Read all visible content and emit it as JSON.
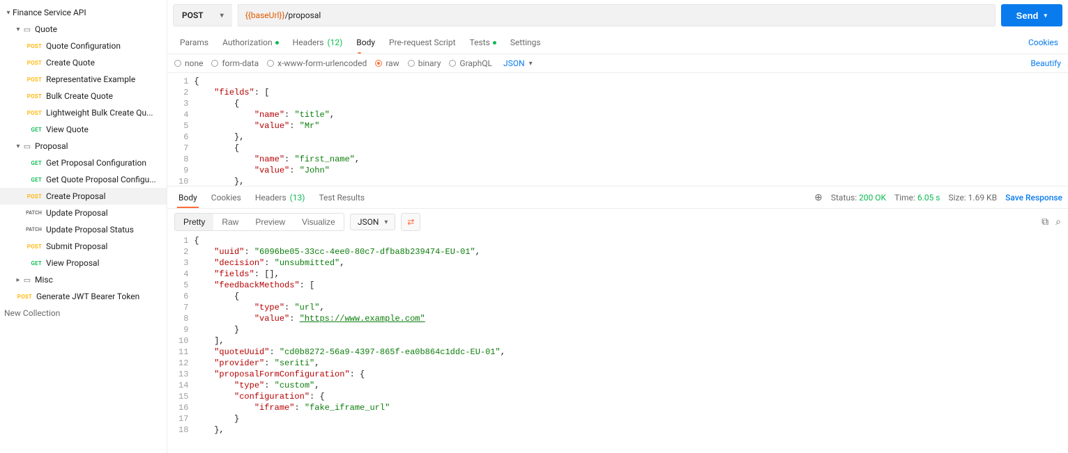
{
  "sidebar": {
    "root": "Finance Service API",
    "folders": [
      {
        "name": "Quote",
        "items": [
          {
            "method": "POST",
            "label": "Quote Configuration"
          },
          {
            "method": "POST",
            "label": "Create Quote"
          },
          {
            "method": "POST",
            "label": "Representative Example"
          },
          {
            "method": "POST",
            "label": "Bulk Create Quote"
          },
          {
            "method": "POST",
            "label": "Lightweight Bulk Create Qu..."
          },
          {
            "method": "GET",
            "label": "View Quote"
          }
        ]
      },
      {
        "name": "Proposal",
        "items": [
          {
            "method": "GET",
            "label": "Get Proposal Configuration"
          },
          {
            "method": "GET",
            "label": "Get Quote Proposal Configu..."
          },
          {
            "method": "POST",
            "label": "Create Proposal",
            "selected": true
          },
          {
            "method": "PATCH",
            "label": "Update Proposal"
          },
          {
            "method": "PATCH",
            "label": "Update Proposal Status"
          },
          {
            "method": "POST",
            "label": "Submit Proposal"
          },
          {
            "method": "GET",
            "label": "View Proposal"
          }
        ]
      },
      {
        "name": "Misc",
        "collapsed": true,
        "items": []
      }
    ],
    "loose": [
      {
        "method": "POST",
        "label": "Generate JWT Bearer Token"
      }
    ],
    "new_collection": "New Collection"
  },
  "request": {
    "method": "POST",
    "url_var": "{{baseUrl}}",
    "url_path": "/proposal",
    "send": "Send",
    "tabs": {
      "params": "Params",
      "auth": "Authorization",
      "headers": "Headers",
      "headers_count": "(12)",
      "body": "Body",
      "prereq": "Pre-request Script",
      "tests": "Tests",
      "settings": "Settings"
    },
    "cookies_link": "Cookies",
    "body_types": {
      "none": "none",
      "form_data": "form-data",
      "urlencoded": "x-www-form-urlencoded",
      "raw": "raw",
      "binary": "binary",
      "graphql": "GraphQL",
      "raw_lang": "JSON"
    },
    "beautify": "Beautify",
    "body_lines": [
      [
        [
          "p",
          "{"
        ]
      ],
      [
        [
          "p",
          "    "
        ],
        [
          "k",
          "\"fields\""
        ],
        [
          "p",
          ": ["
        ]
      ],
      [
        [
          "p",
          "        {"
        ]
      ],
      [
        [
          "p",
          "            "
        ],
        [
          "k",
          "\"name\""
        ],
        [
          "p",
          ": "
        ],
        [
          "s",
          "\"title\""
        ],
        [
          "p",
          ","
        ]
      ],
      [
        [
          "p",
          "            "
        ],
        [
          "k",
          "\"value\""
        ],
        [
          "p",
          ": "
        ],
        [
          "s",
          "\"Mr\""
        ]
      ],
      [
        [
          "p",
          "        },"
        ]
      ],
      [
        [
          "p",
          "        {"
        ]
      ],
      [
        [
          "p",
          "            "
        ],
        [
          "k",
          "\"name\""
        ],
        [
          "p",
          ": "
        ],
        [
          "s",
          "\"first_name\""
        ],
        [
          "p",
          ","
        ]
      ],
      [
        [
          "p",
          "            "
        ],
        [
          "k",
          "\"value\""
        ],
        [
          "p",
          ": "
        ],
        [
          "s",
          "\"John\""
        ]
      ],
      [
        [
          "p",
          "        },"
        ]
      ]
    ]
  },
  "response": {
    "tabs": {
      "body": "Body",
      "cookies": "Cookies",
      "headers": "Headers",
      "headers_count": "(13)",
      "test_results": "Test Results"
    },
    "status_label": "Status:",
    "status_value": "200 OK",
    "time_label": "Time:",
    "time_value": "6.05 s",
    "size_label": "Size:",
    "size_value": "1.69 KB",
    "save_response": "Save Response",
    "view_modes": {
      "pretty": "Pretty",
      "raw": "Raw",
      "preview": "Preview",
      "visualize": "Visualize"
    },
    "lang": "JSON",
    "body_lines": [
      [
        [
          "p",
          "{"
        ]
      ],
      [
        [
          "p",
          "    "
        ],
        [
          "k",
          "\"uuid\""
        ],
        [
          "p",
          ": "
        ],
        [
          "s",
          "\"6096be05-33cc-4ee0-80c7-dfba8b239474-EU-01\""
        ],
        [
          "p",
          ","
        ]
      ],
      [
        [
          "p",
          "    "
        ],
        [
          "k",
          "\"decision\""
        ],
        [
          "p",
          ": "
        ],
        [
          "s",
          "\"unsubmitted\""
        ],
        [
          "p",
          ","
        ]
      ],
      [
        [
          "p",
          "    "
        ],
        [
          "k",
          "\"fields\""
        ],
        [
          "p",
          ": [],"
        ]
      ],
      [
        [
          "p",
          "    "
        ],
        [
          "k",
          "\"feedbackMethods\""
        ],
        [
          "p",
          ": ["
        ]
      ],
      [
        [
          "p",
          "        {"
        ]
      ],
      [
        [
          "p",
          "            "
        ],
        [
          "k",
          "\"type\""
        ],
        [
          "p",
          ": "
        ],
        [
          "s",
          "\"url\""
        ],
        [
          "p",
          ","
        ]
      ],
      [
        [
          "p",
          "            "
        ],
        [
          "k",
          "\"value\""
        ],
        [
          "p",
          ": "
        ],
        [
          "u",
          "\"https://www.example.com\""
        ]
      ],
      [
        [
          "p",
          "        }"
        ]
      ],
      [
        [
          "p",
          "    ],"
        ]
      ],
      [
        [
          "p",
          "    "
        ],
        [
          "k",
          "\"quoteUuid\""
        ],
        [
          "p",
          ": "
        ],
        [
          "s",
          "\"cd0b8272-56a9-4397-865f-ea0b864c1ddc-EU-01\""
        ],
        [
          "p",
          ","
        ]
      ],
      [
        [
          "p",
          "    "
        ],
        [
          "k",
          "\"provider\""
        ],
        [
          "p",
          ": "
        ],
        [
          "s",
          "\"seriti\""
        ],
        [
          "p",
          ","
        ]
      ],
      [
        [
          "p",
          "    "
        ],
        [
          "k",
          "\"proposalFormConfiguration\""
        ],
        [
          "p",
          ": {"
        ]
      ],
      [
        [
          "p",
          "        "
        ],
        [
          "k",
          "\"type\""
        ],
        [
          "p",
          ": "
        ],
        [
          "s",
          "\"custom\""
        ],
        [
          "p",
          ","
        ]
      ],
      [
        [
          "p",
          "        "
        ],
        [
          "k",
          "\"configuration\""
        ],
        [
          "p",
          ": {"
        ]
      ],
      [
        [
          "p",
          "            "
        ],
        [
          "k",
          "\"iframe\""
        ],
        [
          "p",
          ": "
        ],
        [
          "s",
          "\"fake_iframe_url\""
        ]
      ],
      [
        [
          "p",
          "        }"
        ]
      ],
      [
        [
          "p",
          "    },"
        ]
      ]
    ]
  }
}
